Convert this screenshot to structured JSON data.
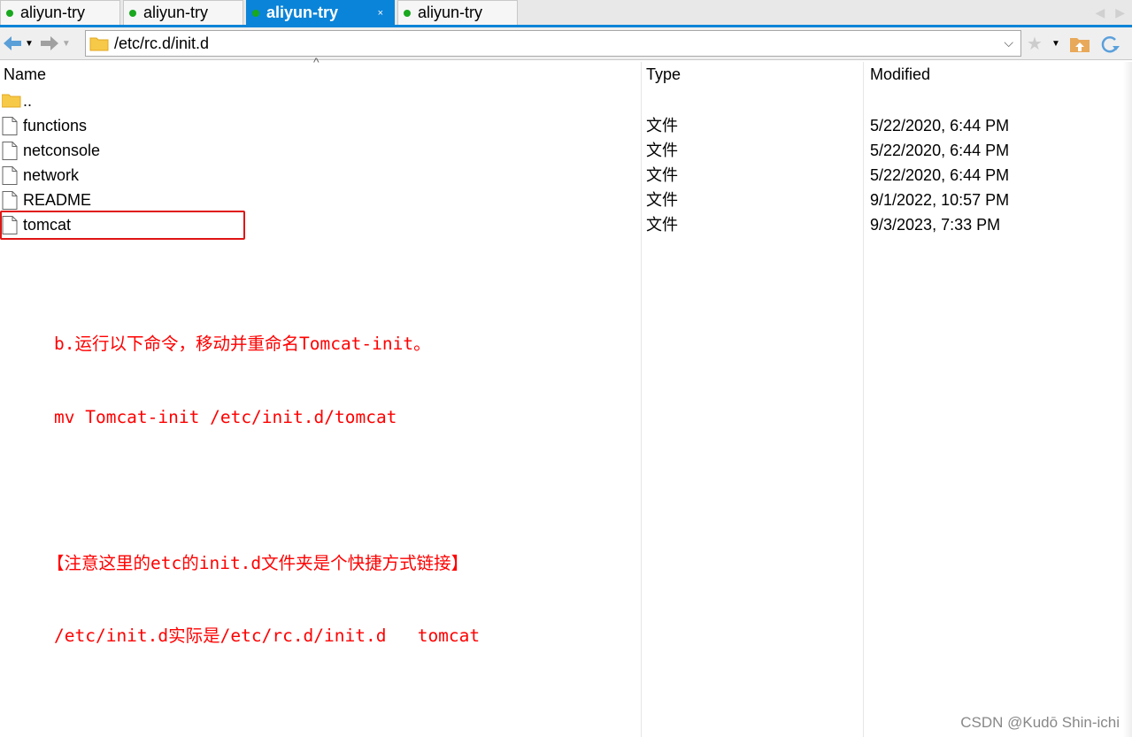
{
  "tabs": [
    {
      "label": "aliyun-try",
      "active": false
    },
    {
      "label": "aliyun-try",
      "active": false
    },
    {
      "label": "aliyun-try",
      "active": true,
      "close": "×"
    },
    {
      "label": "aliyun-try",
      "active": false
    }
  ],
  "toolbar": {
    "path": "/etc/rc.d/init.d"
  },
  "columns": {
    "name": "Name",
    "type": "Type",
    "modified": "Modified"
  },
  "files": [
    {
      "name": "..",
      "type": "",
      "modified": "",
      "icon": "folder-icon"
    },
    {
      "name": "functions",
      "type": "文件",
      "modified": "5/22/2020, 6:44 PM",
      "icon": "file-icon"
    },
    {
      "name": "netconsole",
      "type": "文件",
      "modified": "5/22/2020, 6:44 PM",
      "icon": "file-icon"
    },
    {
      "name": "network",
      "type": "文件",
      "modified": "5/22/2020, 6:44 PM",
      "icon": "file-icon"
    },
    {
      "name": "README",
      "type": "文件",
      "modified": "9/1/2022, 10:57 PM",
      "icon": "file-icon"
    },
    {
      "name": "tomcat",
      "type": "文件",
      "modified": "9/3/2023, 7:33 PM",
      "icon": "file-icon"
    }
  ],
  "annotation": {
    "lines": [
      "b.运行以下命令，移动并重命名Tomcat-init。",
      "mv Tomcat-init /etc/init.d/tomcat",
      "",
      "【注意这里的etc的init.d文件夹是个快捷方式链接】",
      "/etc/init.d实际是/etc/rc.d/init.d   tomcat"
    ]
  },
  "watermark": "CSDN @Kudō Shin-ichi",
  "colors": {
    "accent": "#0a84d8",
    "annotation": "#ff0000",
    "status_dot": "#19a81e"
  }
}
